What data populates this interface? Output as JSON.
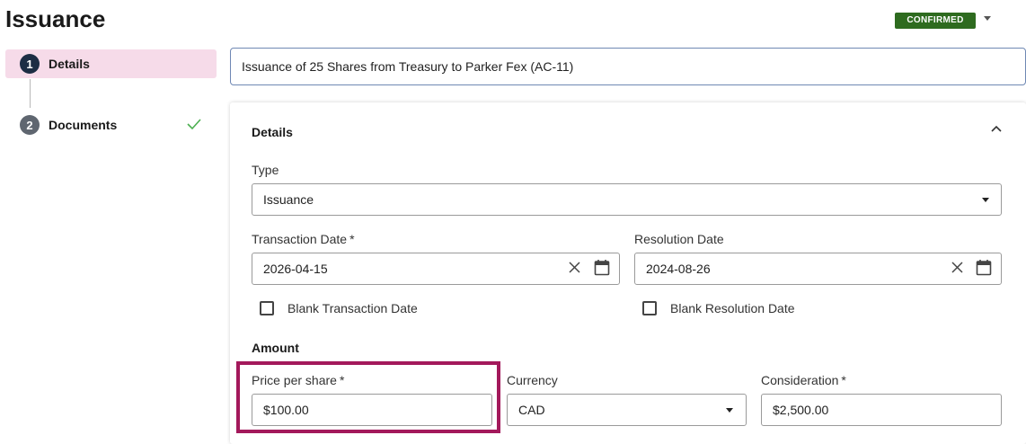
{
  "header": {
    "title": "Issuance",
    "status": "CONFIRMED",
    "status_color": "#2e6b1f"
  },
  "steps": [
    {
      "number": "1",
      "label": "Details",
      "active": true
    },
    {
      "number": "2",
      "label": "Documents",
      "completed": true
    }
  ],
  "transaction_title": "Issuance of 25 Shares from Treasury to Parker Fex (AC-11)",
  "details": {
    "section_title": "Details",
    "type_label": "Type",
    "type_value": "Issuance",
    "transaction_date_label": "Transaction Date",
    "transaction_date_value": "2026-04-15",
    "resolution_date_label": "Resolution Date",
    "resolution_date_value": "2024-08-26",
    "blank_transaction_label": "Blank Transaction Date",
    "blank_resolution_label": "Blank Resolution Date",
    "required_mark": "*"
  },
  "amount": {
    "section_title": "Amount",
    "price_label": "Price per share",
    "price_value": "$100.00",
    "currency_label": "Currency",
    "currency_value": "CAD",
    "consideration_label": "Consideration",
    "consideration_value": "$2,500.00"
  },
  "colors": {
    "active_step_bg": "#f6dbe9",
    "highlight": "#a3195b",
    "focus_border": "#6f88b4"
  }
}
